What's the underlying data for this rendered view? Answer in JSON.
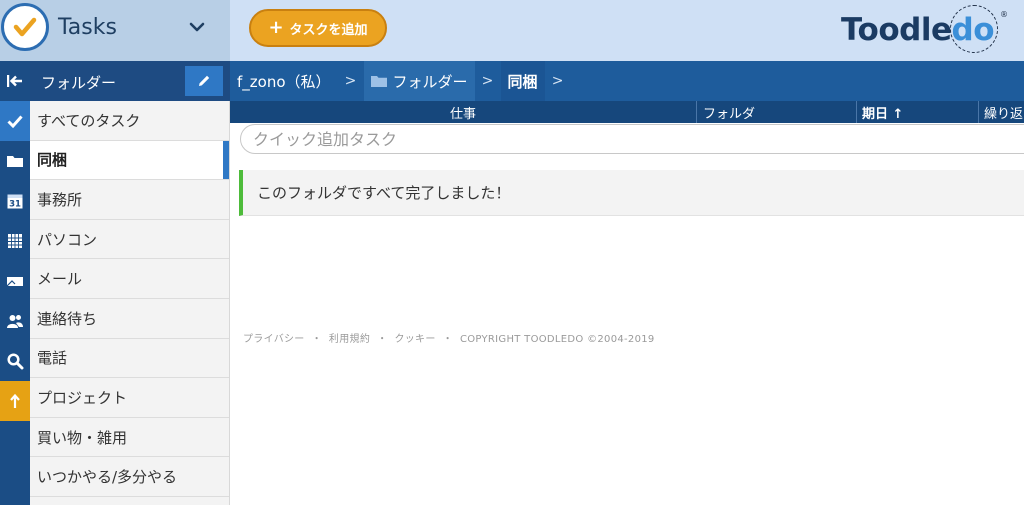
{
  "header": {
    "app_title": "Tasks",
    "add_task_label": "タスクを追加",
    "brand_main": "Toodle",
    "brand_accent": "do",
    "brand_reg": "®"
  },
  "rail": {
    "icons": [
      "collapse-icon",
      "checkmark-icon",
      "folder-icon",
      "calendar-icon",
      "grid-icon",
      "tag-icon",
      "contacts-icon",
      "search-icon",
      "priority-up-icon"
    ],
    "calendar_day": "31"
  },
  "folders_panel": {
    "title": "フォルダー",
    "items": [
      {
        "label": "すべてのタスク"
      },
      {
        "label": "同梱"
      },
      {
        "label": "事務所"
      },
      {
        "label": "パソコン"
      },
      {
        "label": "メール"
      },
      {
        "label": "連絡待ち"
      },
      {
        "label": "電話"
      },
      {
        "label": "プロジェクト"
      },
      {
        "label": "買い物・雑用"
      },
      {
        "label": "いつかやる/多分やる"
      }
    ],
    "selected": "同梱"
  },
  "breadcrumb": {
    "account": "f_zono（私）",
    "folders": "フォルダー",
    "current": "同梱"
  },
  "columns": {
    "task": "仕事",
    "folder": "フォルダ",
    "due": "期日 ↑",
    "repeat": "繰り返"
  },
  "main": {
    "quick_add_placeholder": "クイック追加タスク",
    "done_message": "このフォルダですべて完了しました！"
  },
  "footer": {
    "privacy": "プライバシー",
    "terms": "利用規約",
    "cookies": "クッキー",
    "copyright": "COPYRIGHT TOODLEDO ©2004-2019",
    "separator": "・"
  },
  "colors": {
    "accent": "#2f78c5",
    "add_button": "#eba321",
    "header_dark": "#1e5c9c",
    "complete_green": "#4dbb3a"
  }
}
